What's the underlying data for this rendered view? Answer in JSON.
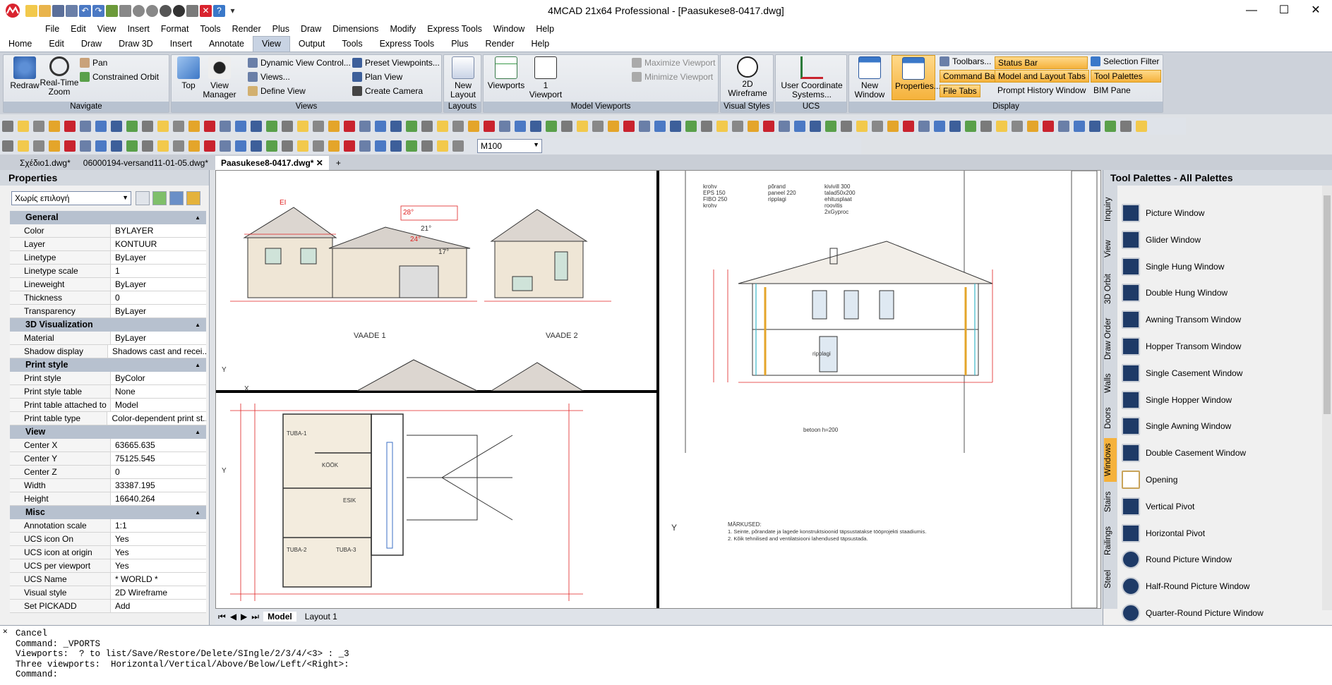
{
  "app": {
    "title": "4MCAD 21x64 Professional - [Paasukese8-0417.dwg]",
    "accent": "#f5b23c",
    "brand_color": "#d9232e"
  },
  "window_controls": {
    "minimize": "—",
    "maximize": "☐",
    "close": "✕"
  },
  "menu": [
    "File",
    "Edit",
    "View",
    "Insert",
    "Format",
    "Tools",
    "Render",
    "Plus",
    "Draw",
    "Dimensions",
    "Modify",
    "Express Tools",
    "Window",
    "Help"
  ],
  "ribbon_tabs": [
    "Home",
    "Edit",
    "Draw",
    "Draw 3D",
    "Insert",
    "Annotate",
    "View",
    "Output",
    "Tools",
    "Express Tools",
    "Plus",
    "Render",
    "Help"
  ],
  "ribbon": {
    "navigate": {
      "title": "Navigate",
      "redraw": "Redraw",
      "realtime_zoom": "Real-Time Zoom",
      "pan": "Pan",
      "constrained_orbit": "Constrained Orbit"
    },
    "views": {
      "title": "Views",
      "top": "Top",
      "view_manager": "View Manager",
      "dynamic_view": "Dynamic View Control...",
      "views": "Views...",
      "define_view": "Define View",
      "preset": "Preset Viewpoints...",
      "plan_view": "Plan View",
      "create_camera": "Create Camera"
    },
    "layouts": {
      "title": "Layouts",
      "new_layout": "New Layout"
    },
    "model_viewports": {
      "title": "Model Viewports",
      "viewports": "Viewports",
      "one_viewport": "1 Viewport",
      "maximize": "Maximize Viewport",
      "minimize": "Minimize Viewport"
    },
    "visual_styles": {
      "title": "Visual Styles",
      "wireframe": "2D Wireframe"
    },
    "ucs": {
      "title": "UCS",
      "ucs_systems": "User Coordinate Systems..."
    },
    "display": {
      "title": "Display",
      "new_window": "New Window",
      "properties": "Properties...",
      "toolbars": "Toolbars...",
      "command_bar": "Command Bar",
      "file_tabs": "File Tabs",
      "status_bar": "Status Bar",
      "model_layout_tabs": "Model and Layout Tabs",
      "prompt_history": "Prompt History Window",
      "selection_filter": "Selection Filter",
      "tool_palettes": "Tool Palettes",
      "bim_pane": "BIM Pane"
    }
  },
  "scale_combo": "M100",
  "doc_tabs": [
    "Σχέδιο1.dwg*",
    "06000194-versand11-01-05.dwg*",
    "Paasukese8-0417.dwg*"
  ],
  "properties": {
    "title": "Properties",
    "selection": "Χωρίς επιλογή",
    "sections": [
      {
        "name": "General",
        "rows": [
          [
            "Color",
            "BYLAYER"
          ],
          [
            "Layer",
            "KONTUUR"
          ],
          [
            "Linetype",
            "ByLayer"
          ],
          [
            "Linetype scale",
            "1"
          ],
          [
            "Lineweight",
            "ByLayer"
          ],
          [
            "Thickness",
            "0"
          ],
          [
            "Transparency",
            "ByLayer"
          ]
        ]
      },
      {
        "name": "3D Visualization",
        "rows": [
          [
            "Material",
            "ByLayer"
          ],
          [
            "Shadow display",
            "Shadows cast and recei..."
          ]
        ]
      },
      {
        "name": "Print style",
        "rows": [
          [
            "Print style",
            "ByColor"
          ],
          [
            "Print style table",
            "None"
          ],
          [
            "Print table attached to",
            "Model"
          ],
          [
            "Print table type",
            "Color-dependent print st..."
          ]
        ]
      },
      {
        "name": "View",
        "rows": [
          [
            "Center X",
            "63665.635"
          ],
          [
            "Center Y",
            "75125.545"
          ],
          [
            "Center Z",
            "0"
          ],
          [
            "Width",
            "33387.195"
          ],
          [
            "Height",
            "16640.264"
          ]
        ]
      },
      {
        "name": "Misc",
        "rows": [
          [
            "Annotation scale",
            "1:1"
          ],
          [
            "UCS icon On",
            "Yes"
          ],
          [
            "UCS icon at origin",
            "Yes"
          ],
          [
            "UCS per viewport",
            "Yes"
          ],
          [
            "UCS Name",
            "* WORLD *"
          ],
          [
            "Visual style",
            "2D Wireframe"
          ],
          [
            "Set PICKADD",
            "Add"
          ]
        ]
      }
    ]
  },
  "drawing": {
    "vaade1": "VAADE 1",
    "vaade2": "VAADE 2",
    "angle1": "28°",
    "angle2": "24°",
    "angle3": "21°",
    "angle4": "17°",
    "marker": "EI",
    "rooms": [
      "TUBA-1",
      "TUBA-2",
      "TUBA-3",
      "KÖÖK",
      "ESIK"
    ],
    "notes_title": "MÄRKUSED:",
    "note1": "1. Seinte, põrandate ja lagede konstruktsioonid täpsustatakse tööprojekti staadiumis.",
    "note2": "2. Kõik tehnilised and ventilatsiooni lahendused täpsustada.",
    "ripplagi": "ripplagi",
    "betoon": "betoon h=200",
    "layers_left": [
      "krohv",
      "EPS 150",
      "FIBO 250",
      "krohv"
    ],
    "layers_mid": [
      "põrand",
      "paneel 220",
      "ripplagi"
    ],
    "layers_roof": [
      "kivivill 300",
      "talad50x200",
      "ehitusplaat",
      "roovitis",
      "2xGyproc"
    ],
    "axis_y": "Y",
    "axis_x": "X"
  },
  "layout_tabs": [
    "Model",
    "Layout 1"
  ],
  "palettes": {
    "title": "Tool Palettes - All Palettes",
    "vtabs": [
      "Inquiry",
      "View",
      "3D Orbit",
      "Draw Order",
      "Walls",
      "Doors",
      "Windows",
      "Stairs",
      "Railings",
      "Steel"
    ],
    "active_vtab": "Windows",
    "items": [
      "Picture Window",
      "Glider Window",
      "Single Hung Window",
      "Double Hung Window",
      "Awning Transom Window",
      "Hopper Transom Window",
      "Single Casement Window",
      "Single Hopper Window",
      "Single Awning Window",
      "Double Casement Window",
      "Opening",
      "Vertical Pivot",
      "Horizontal Pivot",
      "Round Picture Window",
      "Half-Round Picture Window",
      "Quarter-Round Picture Window"
    ]
  },
  "command_line": [
    "Cancel",
    "Command: _VPORTS",
    "Viewports:  ? to list/Save/Restore/Delete/SIngle/2/3/4/<3> : _3",
    "Three viewports:  Horizontal/Vertical/Above/Below/Left/<Right>:",
    "Command:"
  ]
}
